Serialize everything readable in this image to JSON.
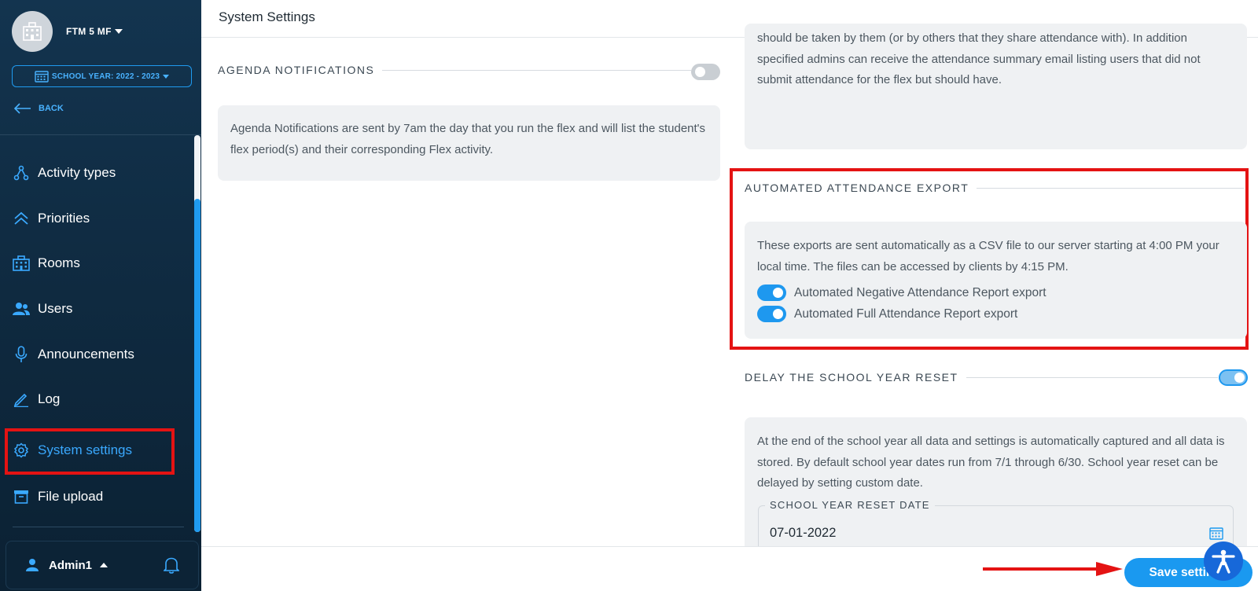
{
  "sidebar": {
    "org_name": "FTM 5 MF",
    "school_year": "SCHOOL YEAR: 2022 - 2023",
    "back_label": "BACK",
    "items": [
      {
        "label": "Activity types",
        "icon": "sitemap-icon"
      },
      {
        "label": "Priorities",
        "icon": "double-chevron-up-icon"
      },
      {
        "label": "Rooms",
        "icon": "building-icon"
      },
      {
        "label": "Users",
        "icon": "users-icon"
      },
      {
        "label": "Announcements",
        "icon": "microphone-icon"
      },
      {
        "label": "Log",
        "icon": "pencil-icon"
      },
      {
        "label": "System settings",
        "icon": "gear-icon",
        "active": true
      },
      {
        "label": "File upload",
        "icon": "archive-icon"
      }
    ],
    "user_name": "Admin1"
  },
  "header": {
    "title": "System Settings"
  },
  "agenda": {
    "title": "AGENDA NOTIFICATIONS",
    "enabled": false,
    "description": "Agenda Notifications are sent by 7am the day that you run the flex and will list the student's flex period(s) and their corresponding Flex activity."
  },
  "attendance_summary": {
    "line1": "should be taken by them (or by others that they share attendance with). In addition",
    "line2": "specified admins can receive the attendance summary email listing users that did not",
    "line3": "submit attendance for the flex but should have."
  },
  "export": {
    "title": "AUTOMATED ATTENDANCE EXPORT",
    "description": "These exports are sent automatically as a CSV file to our server starting at 4:00 PM your local time. The files can be accessed by clients by 4:15 PM.",
    "options": [
      {
        "label": "Automated Negative Attendance Report export",
        "enabled": true
      },
      {
        "label": "Automated Full Attendance Report export",
        "enabled": true
      }
    ]
  },
  "delay_reset": {
    "title": "DELAY THE SCHOOL YEAR RESET",
    "enabled": true,
    "description": "At the end of the school year all data and settings is automatically captured and all data is stored. By default school year dates run from 7/1 through 6/30. School year reset can be delayed by setting custom date.",
    "date_label": "SCHOOL YEAR RESET DATE",
    "date_value": "07-01-2022"
  },
  "footer": {
    "save_label": "Save settings"
  },
  "colors": {
    "accent": "#1a99f0",
    "highlight": "#e41313",
    "sidebar_bg": "#13344f"
  }
}
